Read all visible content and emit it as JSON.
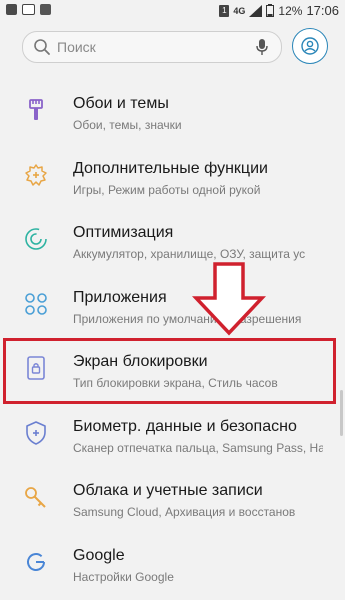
{
  "status_bar": {
    "network": "4G",
    "battery_percent": "12%",
    "time": "17:06",
    "sim": "1"
  },
  "search": {
    "placeholder": "Поиск"
  },
  "settings": [
    {
      "title": "Обои и темы",
      "subtitle": "Обои, темы, значки",
      "icon": "paint-brush-icon",
      "color": "#8a63c9"
    },
    {
      "title": "Дополнительные функции",
      "subtitle": "Игры, Режим работы одной рукой",
      "icon": "gear-plus-icon",
      "color": "#e8a646"
    },
    {
      "title": "Оптимизация",
      "subtitle": "Аккумулятор, хранилище, ОЗУ, защита ус",
      "icon": "optimization-icon",
      "color": "#2eb3a2"
    },
    {
      "title": "Приложения",
      "subtitle": "Приложения по умолчанию, Разрешения",
      "icon": "apps-grid-icon",
      "color": "#4a9fd6"
    },
    {
      "title": "Экран блокировки",
      "subtitle": "Тип блокировки экрана, Стиль часов",
      "icon": "lock-screen-icon",
      "color": "#7b86d6"
    },
    {
      "title": "Биометр. данные и безопасно",
      "subtitle": "Сканер отпечатка пальца, Samsung Pass, Найти",
      "icon": "shield-icon",
      "color": "#6a7fd0"
    },
    {
      "title": "Облака и учетные записи",
      "subtitle": "Samsung Cloud, Архивация и восстанов",
      "icon": "key-icon",
      "color": "#e8a646"
    },
    {
      "title": "Google",
      "subtitle": "Настройки Google",
      "icon": "google-icon",
      "color": "#4a86d6"
    }
  ],
  "accent_colors": {
    "highlight": "#d0212e",
    "account": "#2a86b8"
  }
}
